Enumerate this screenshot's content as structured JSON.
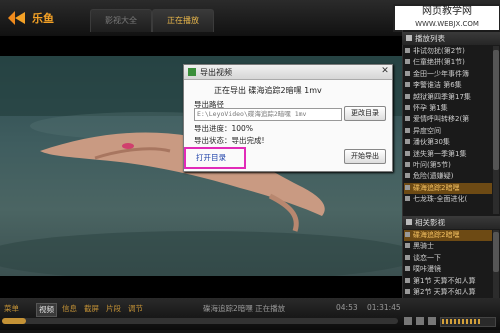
{
  "app": {
    "name": "乐鱼"
  },
  "tabs": [
    "影视大全",
    "正在播放"
  ],
  "watermark": {
    "line1": "网页教学网",
    "line2": "WWW.WEBJX.COM"
  },
  "dialog": {
    "title": "导出视频",
    "close": "✕",
    "status": "正在导出  碟海追踪2暗嘿 1mv",
    "path_label": "导出路径",
    "path_value": "E:\\LeyoVideo\\碟海追踪2暗嘿 1mv",
    "change_dir": "更改目录",
    "progress": "导出进度：100%",
    "progress_value": 100,
    "state": "导出状态：导出完成!",
    "open_dir": "打开目录",
    "start": "开始导出"
  },
  "playlist": {
    "header": "播放列表",
    "items": [
      "非试勿扰(第2节)",
      "仨童绝拼(第1节)",
      "金田一少年事件簿",
      "李警谁洁 第6集",
      "越狱第四季第17集",
      "怀孕 第1集",
      "爱情呼叫转移2(第",
      "异度空间",
      "潘伙第30集",
      "迷失第一季第1集",
      "叶问(第5节)",
      "危险(遗嫌疑)",
      "碟海追踪2暗嘿",
      "七龙珠-全面进化("
    ],
    "selected_index": 12,
    "related_header": "相关影视",
    "related_items": [
      "碟海追踪2暗嘿",
      "黑骑士",
      "谈恋一下",
      "噗咔漫镜",
      "第1节 天算不如人算",
      "第2节 天算不如人算",
      "101条狼身",
      "死神专剧：死后的生活",
      "爆炸的第7(第1节)"
    ],
    "related_selected_index": 0
  },
  "bottom": {
    "tabs": [
      "菜单",
      "视频",
      "信息",
      "截屏",
      "片段",
      "调节"
    ],
    "active_tab": 1,
    "now_playing": "碟海追踪2暗嘿 正在播放",
    "time_current": "04:53",
    "time_total": "01:31:45",
    "seek_fraction": 0.06,
    "volume_fraction": 0.85
  },
  "colors": {
    "accent": "#c49236",
    "highlight_box": "#e12bb8",
    "selected_row": "#6d4a14"
  }
}
